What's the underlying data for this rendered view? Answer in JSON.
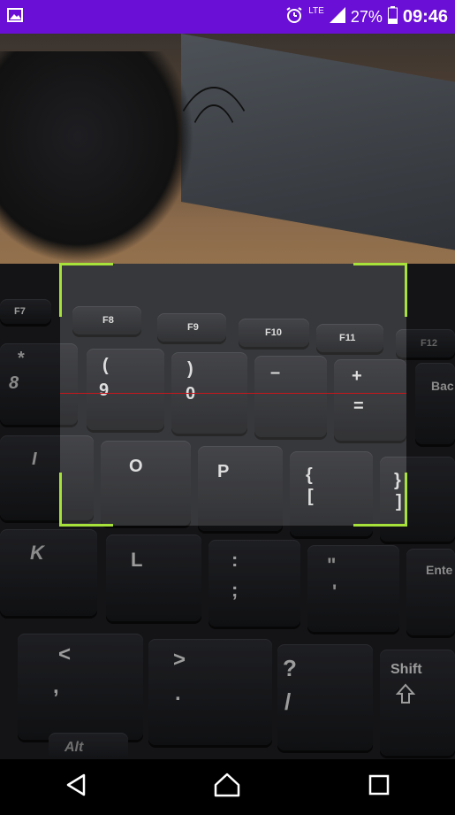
{
  "status_bar": {
    "battery_percent": "27%",
    "time": "09:46",
    "network": "LTE",
    "background": "#6a0fd6"
  },
  "scanner": {
    "corner_color": "#a6e23a",
    "laser_color": "#c4161c"
  },
  "keyboard_keys": {
    "f7": "F7",
    "f8": "F8",
    "f9": "F9",
    "f10": "F10",
    "f11": "F11",
    "f12": "F12",
    "star": "*",
    "eight": "8",
    "paren_open": "(",
    "nine": "9",
    "paren_close": ")",
    "zero": "0",
    "minus": "–",
    "plus": "+",
    "equals": "=",
    "back": "Bac",
    "i": "I",
    "o": "O",
    "p": "P",
    "brace_open": "{",
    "bracket_open": "[",
    "brace_close": "}",
    "bracket_close": "]",
    "k": "K",
    "l": "L",
    "colon": ":",
    "semicolon": ";",
    "quote": "\"",
    "apostrophe": "'",
    "enter": "Ente",
    "lt": "<",
    "comma": ",",
    "gt": ">",
    "period": ".",
    "question": "?",
    "slash": "/",
    "shift": "Shift",
    "alt": "Alt"
  },
  "nav_bar": {
    "back_icon": "back-triangle-icon",
    "home_icon": "home-icon",
    "recents_icon": "recents-square-icon"
  }
}
